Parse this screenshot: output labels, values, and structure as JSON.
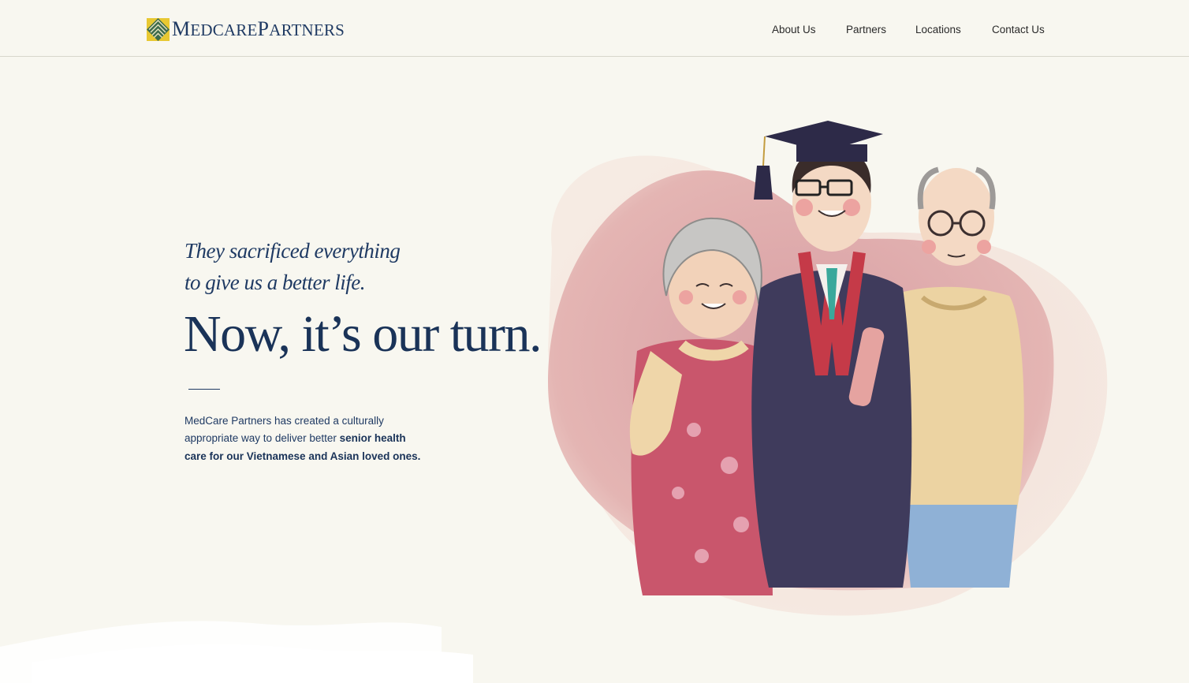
{
  "brand": {
    "name_part1_cap": "M",
    "name_part1": "EDCARE",
    "name_part2_cap": "P",
    "name_part2": "ARTNERS",
    "logo_colors": {
      "green": "#3d6b4c",
      "yellow": "#e8c832",
      "navy": "#1f3a63"
    }
  },
  "nav": {
    "items": [
      {
        "label": "About Us"
      },
      {
        "label": "Partners"
      },
      {
        "label": "Locations"
      },
      {
        "label": "Contact Us"
      }
    ]
  },
  "hero": {
    "tagline_line1": "They sacrificed everything",
    "tagline_line2": "to give us a better life.",
    "headline": "Now, it’s our turn.",
    "description_plain": "MedCare Partners has created a culturally appropriate way to deliver better ",
    "description_bold": "senior health care for our Vietnamese and Asian loved ones."
  },
  "theme": {
    "background": "#f8f7f0",
    "navy": "#1f3a63",
    "blob_pink": "#dea7ab",
    "blob_light": "#f0dcd6"
  }
}
